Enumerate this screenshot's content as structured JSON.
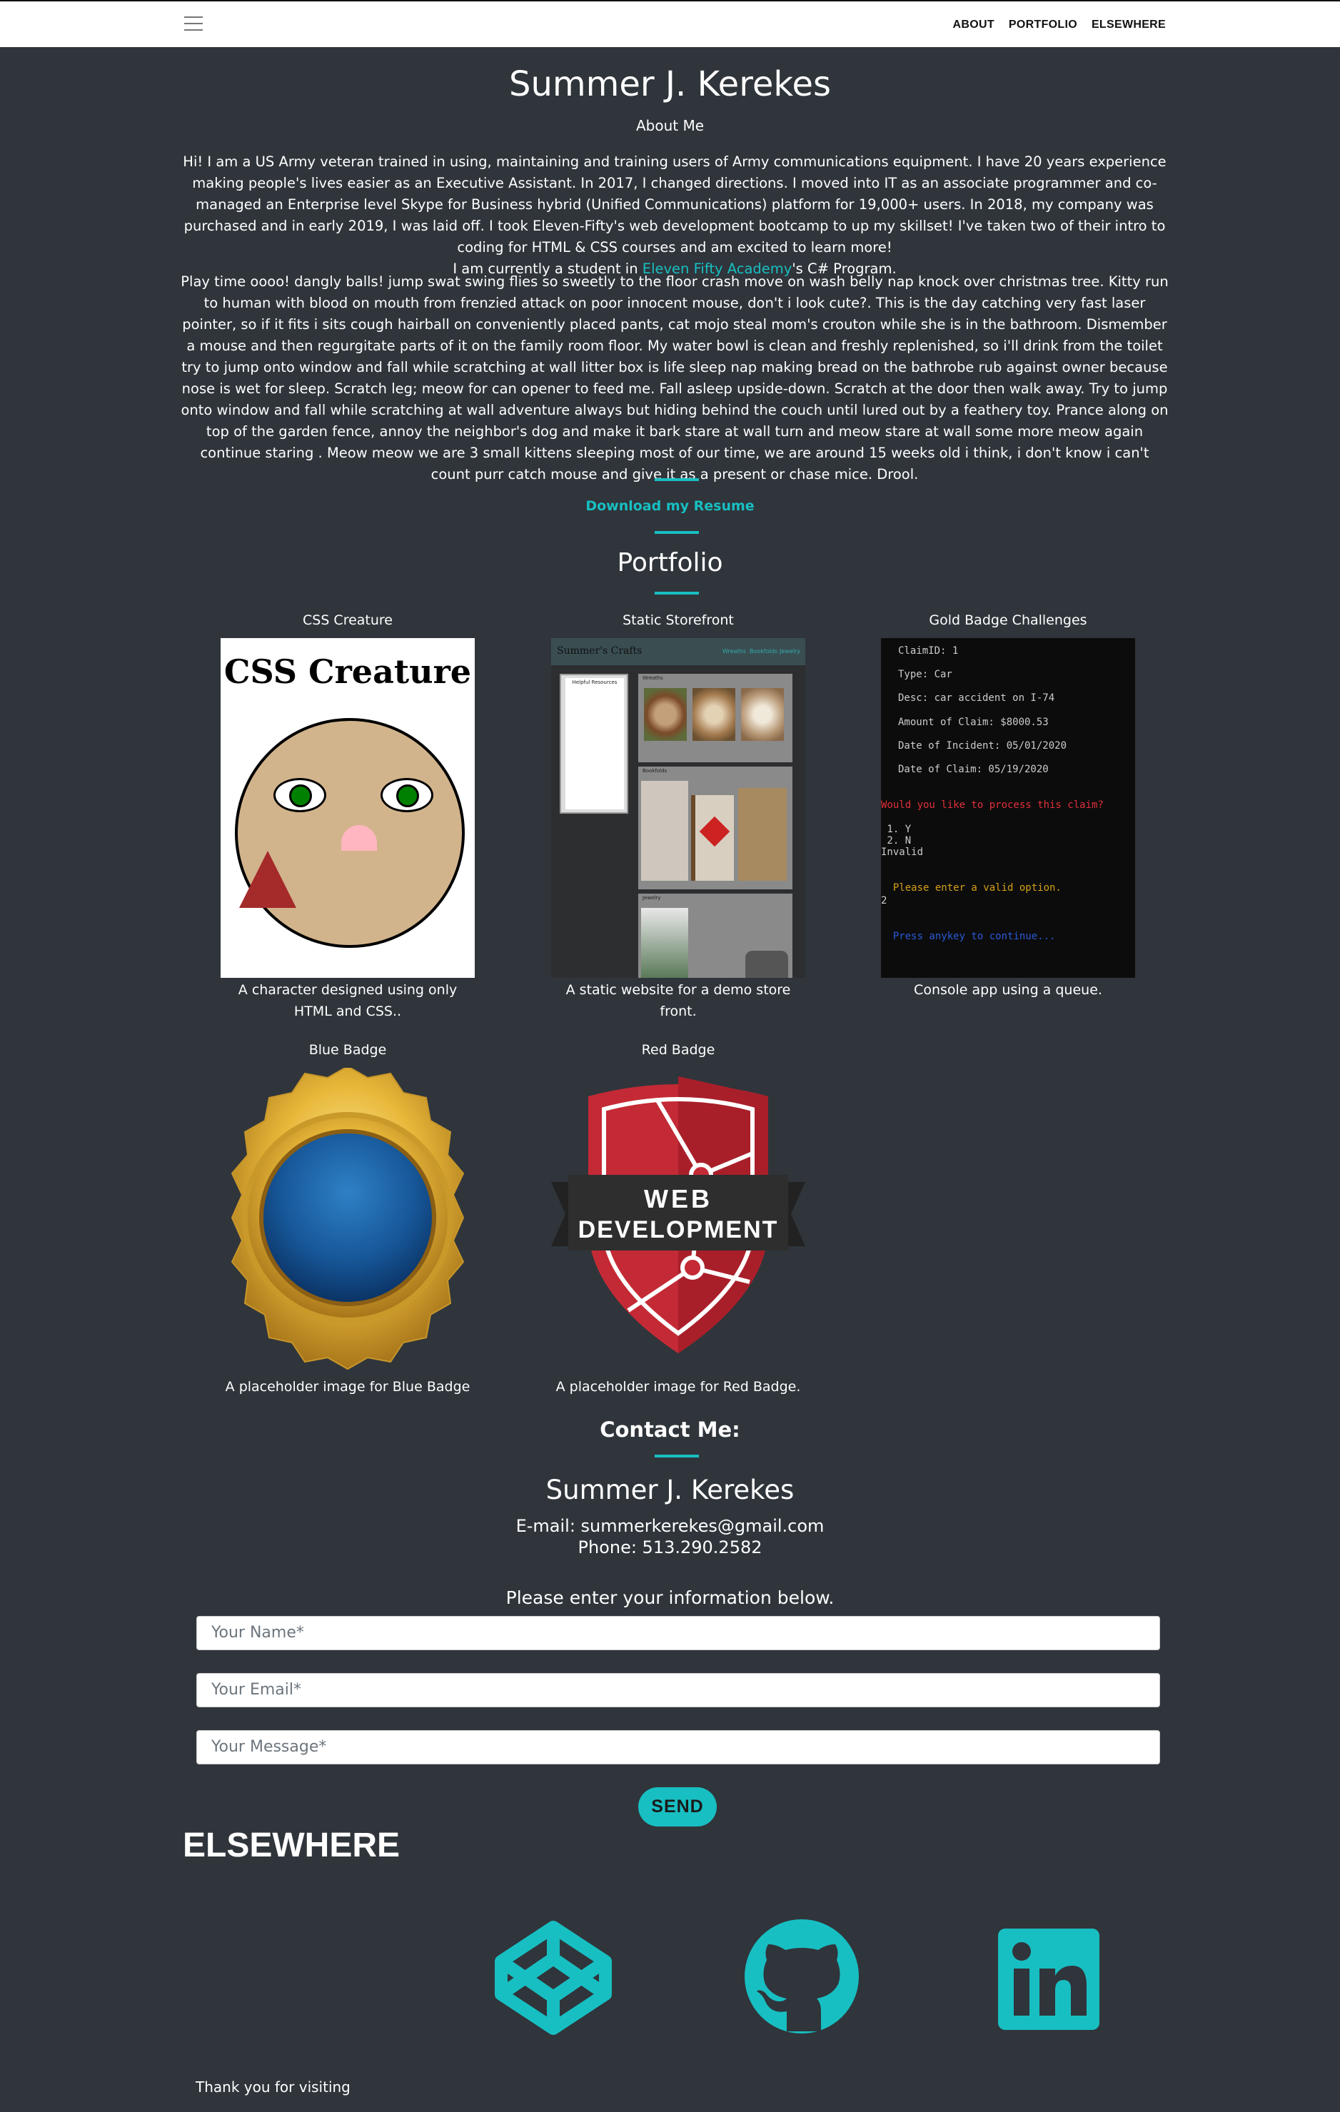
{
  "nav": {
    "items": [
      "ABOUT",
      "PORTFOLIO",
      "ELSEWHERE"
    ]
  },
  "header": {
    "name": "Summer J. Kerekes",
    "about_label": "About Me"
  },
  "about": {
    "paragraph": "Hi! I am a US Army veteran trained in using, maintaining and training users of Army communications equipment. I have 20 years experience making people's lives easier as an Executive Assistant. In 2017, I changed directions. I moved into IT as an associate programmer and co-managed an Enterprise level Skype for Business hybrid (Unified Communications) platform for 19,000+ users. In 2018, my company was purchased and in early 2019, I was laid off. I took Eleven-Fifty's web development bootcamp to up my skillset! I've taken two of their intro to coding for HTML & CSS courses and am excited to learn more!",
    "student_prefix": "I am currently a student in ",
    "student_link": "Eleven Fifty Academy",
    "student_suffix": "'s C# Program.",
    "filler": "Play time oooo! dangly balls! jump swat swing flies so sweetly to the floor crash move on wash belly nap knock over christmas tree. Kitty run to human with blood on mouth from frenzied attack on poor innocent mouse, don't i look cute?. This is the day catching very fast laser pointer, so if it fits i sits cough hairball on conveniently placed pants, cat mojo steal mom's crouton while she is in the bathroom. Dismember a mouse and then regurgitate parts of it on the family room floor. My water bowl is clean and freshly replenished, so i'll drink from the toilet try to jump onto window and fall while scratching at wall litter box is life sleep nap making bread on the bathrobe rub against owner because nose is wet for sleep. Scratch leg; meow for can opener to feed me. Fall asleep upside-down. Scratch at the door then walk away. Try to jump onto window and fall while scratching at wall adventure always but hiding behind the couch until lured out by a feathery toy. Prance along on top of the garden fence, annoy the neighbor's dog and make it bark stare at wall turn and meow stare at wall some more meow again continue staring . Meow meow we are 3 small kittens sleeping most of our time, we are around 15 weeks old i think, i don't know i can't count purr catch mouse and give it as a present or chase mice. Drool.",
    "resume_link": "Download my Resume"
  },
  "portfolio": {
    "title": "Portfolio",
    "items": [
      {
        "label": "CSS Creature",
        "caption": "A character designed using only HTML and CSS..",
        "thumb_title": "CSS Creature"
      },
      {
        "label": "Static Storefront",
        "caption": "A static website for a demo store front.",
        "thumb_title": "Summer's Crafts",
        "thumb_nav": [
          "Wreaths",
          "Bookfolds",
          "Jewelry"
        ],
        "thumb_sidebar": "Helpful Resources",
        "thumb_sections": [
          "Wreaths",
          "Bookfolds",
          "Jewelry"
        ]
      },
      {
        "label": "Gold Badge Challenges",
        "caption": "Console app using a queue.",
        "console": {
          "lines": [
            "ClaimID: 1",
            "Type: Car",
            "Desc: car accident on I-74",
            "Amount of Claim: $8000.53",
            "Date of Incident: 05/01/2020",
            "Date of Claim: 05/19/2020"
          ],
          "prompt": "Would you like to process this claim?",
          "options": [
            " 1. Y",
            " 2. N"
          ],
          "invalid": "Invalid",
          "warning": "  Please enter a valid option.",
          "input": "2",
          "continue": "  Press anykey to continue..."
        }
      },
      {
        "label": "Blue Badge",
        "caption": "A placeholder image for Blue Badge"
      },
      {
        "label": "Red Badge",
        "caption": "A placeholder image for Red Badge.",
        "badge_text": [
          "WEB",
          "DEVELOPMENT"
        ]
      }
    ]
  },
  "contact": {
    "title": "Contact Me:",
    "name": "Summer J. Kerekes",
    "email": "E-mail: summerkerekes@gmail.com",
    "phone": "Phone: 513.290.2582",
    "prompt": "Please enter your information below.",
    "name_placeholder": "Your Name*",
    "email_placeholder": "Your Email*",
    "message_placeholder": "Your Message*",
    "send_label": "SEND"
  },
  "elsewhere": {
    "title": "ELSEWHERE",
    "icons": [
      "codepen-icon",
      "github-icon",
      "linkedin-icon"
    ],
    "accent": "#18bfc2"
  },
  "footer": {
    "text": "Thank you for visiting"
  },
  "colors": {
    "background": "#2f353b",
    "accent": "#18bfc2",
    "navbar": "#ffffff"
  }
}
